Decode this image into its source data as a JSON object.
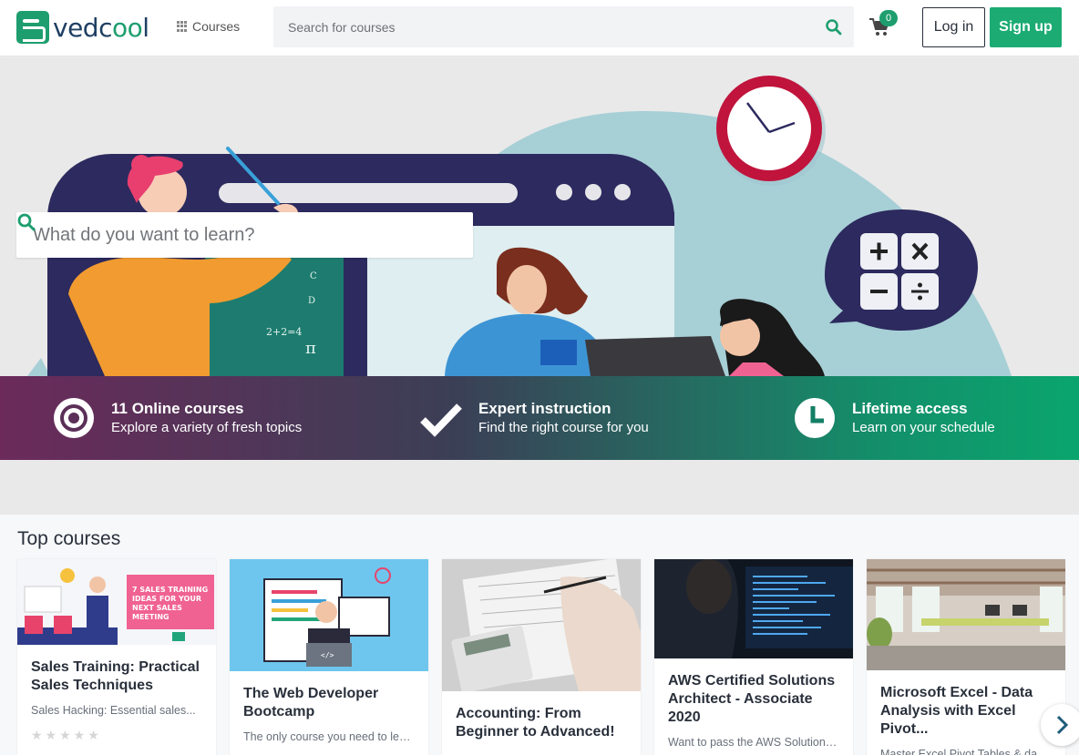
{
  "header": {
    "logo_text_a": "vedc",
    "logo_text_b": "oo",
    "logo_text_c": "l",
    "courses_label": "Courses",
    "search_placeholder": "Search for courses",
    "cart_count": "0",
    "login_label": "Log in",
    "signup_label": "Sign up"
  },
  "hero": {
    "search_placeholder": "What do you want to learn?"
  },
  "features": [
    {
      "title": "11 Online courses",
      "subtitle": "Explore a variety of fresh topics",
      "icon": "target-icon"
    },
    {
      "title": "Expert instruction",
      "subtitle": "Find the right course for you",
      "icon": "checkmark-icon"
    },
    {
      "title": "Lifetime access",
      "subtitle": "Learn on your schedule",
      "icon": "clock-icon"
    }
  ],
  "top_courses": {
    "heading": "Top courses",
    "courses": [
      {
        "title": "Sales Training: Practical Sales Techniques",
        "description": "Sales Hacking: Essential sales...",
        "thumb_text": "7 SALES TRAINING IDEAS FOR YOUR NEXT SALES MEETING"
      },
      {
        "title": "The Web Developer Bootcamp",
        "description": "The only course you need to lear..."
      },
      {
        "title": "Accounting: From Beginner to Advanced!",
        "description": ""
      },
      {
        "title": "AWS Certified Solutions Architect - Associate 2020",
        "description": "Want to pass the AWS Solutions..."
      },
      {
        "title": "Microsoft Excel - Data Analysis with Excel Pivot...",
        "description": "Master Excel Pivot Tables & data..."
      }
    ]
  },
  "colors": {
    "brand_green": "#1bab73",
    "navy": "#2a2a63",
    "clock_red": "#c0143c"
  }
}
